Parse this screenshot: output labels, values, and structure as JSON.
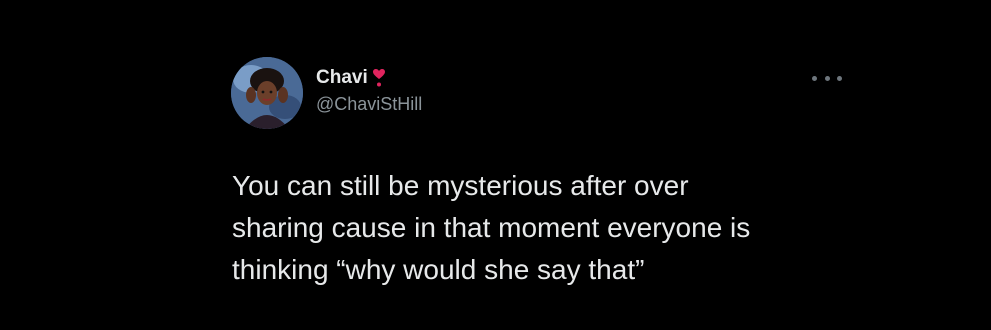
{
  "tweet": {
    "author": {
      "display_name": "Chavi",
      "handle": "@ChaviStHill",
      "badge_icon": "red-heart-exclamation-icon",
      "avatar": "profile-photo"
    },
    "menu_icon": "more-options-icon",
    "text": "You can still be mysterious after over\nsharing cause in that moment everyone is\nthinking “why would she say that”"
  },
  "colors": {
    "background": "#000000",
    "text_primary": "#e7e9ea",
    "text_secondary": "#8b949a",
    "heart": "#e0245e"
  }
}
